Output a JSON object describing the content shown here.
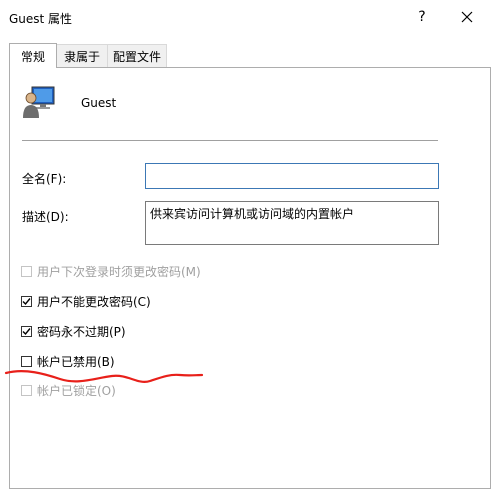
{
  "window": {
    "title": "Guest 属性",
    "help_glyph": "?",
    "close_glyph": "✕"
  },
  "tabs": [
    {
      "label": "常规",
      "active": true
    },
    {
      "label": "隶属于",
      "active": false
    },
    {
      "label": "配置文件",
      "active": false
    }
  ],
  "user": {
    "name": "Guest",
    "icon": "user-monitor-icon"
  },
  "form": {
    "fullname_label": "全名(F):",
    "fullname_value": "",
    "description_label": "描述(D):",
    "description_value": "供来宾访问计算机或访问域的内置帐户"
  },
  "checkboxes": [
    {
      "label": "用户下次登录时须更改密码(M)",
      "checked": false,
      "disabled": true
    },
    {
      "label": "用户不能更改密码(C)",
      "checked": true,
      "disabled": false
    },
    {
      "label": "密码永不过期(P)",
      "checked": true,
      "disabled": false
    },
    {
      "label": "帐户已禁用(B)",
      "checked": false,
      "disabled": false
    },
    {
      "label": "帐户已锁定(O)",
      "checked": false,
      "disabled": true
    }
  ],
  "colors": {
    "annotation_red": "#e8201a",
    "focus_border": "#3c78b5"
  }
}
